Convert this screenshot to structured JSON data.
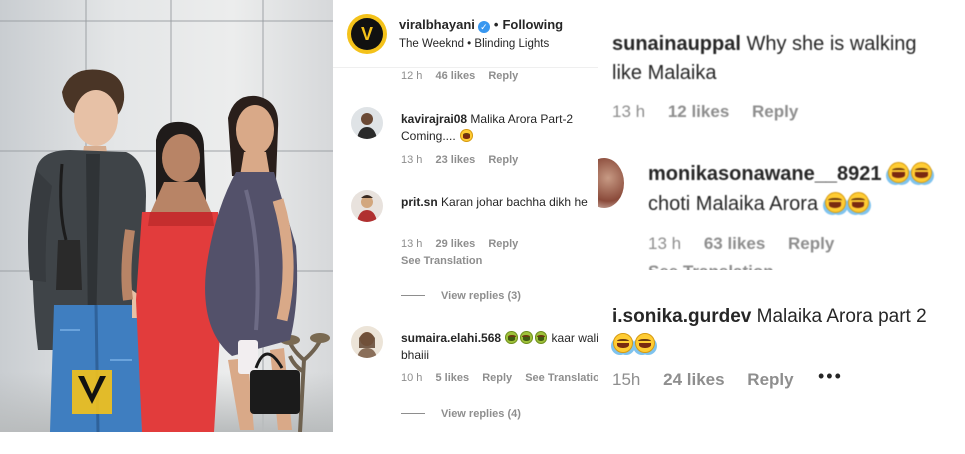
{
  "post": {
    "username": "viralbhayani",
    "follow_status": "Following",
    "song": "The Weeknd • Blinding Lights",
    "photo_watermark": "VIRAL BHAYANI"
  },
  "comments": {
    "top_meta": {
      "time": "12 h",
      "likes": "46 likes",
      "reply": "Reply"
    },
    "items": [
      {
        "username": "kavirajrai08",
        "text": "Malika Arora Part-2 Coming....",
        "emoji": "😆",
        "time": "13 h",
        "likes": "23 likes",
        "reply": "Reply"
      },
      {
        "username": "prit.sn",
        "text": "Karan johar bachha dikh he",
        "time": "13 h",
        "likes": "29 likes",
        "reply": "Reply",
        "see_translation": "See Translation",
        "view_replies": "View replies (3)"
      },
      {
        "username": "sumaira.elahi.568",
        "text": "kaar wali bhaiii",
        "emoji": "🤮🤮🤮",
        "time": "10 h",
        "likes": "5 likes",
        "reply": "Reply",
        "see_translation": "See Translatio",
        "view_replies": "View replies (4)"
      }
    ]
  },
  "zoomed_comments": [
    {
      "username": "sunainauppal",
      "text_line1": "Why she is walking",
      "text_line2": "like Malaika",
      "time": "13 h",
      "likes": "12 likes",
      "reply": "Reply"
    },
    {
      "username": "monikasonawane__8921",
      "text_line2": "choti Malaika Arora",
      "time": "13 h",
      "likes": "63 likes",
      "reply": "Reply",
      "cut_text": "See Translation"
    },
    {
      "username": "i.sonika.gurdev",
      "text": "Malaika Arora part 2",
      "emoji": "😂😂",
      "time": "15h",
      "likes": "24 likes",
      "reply": "Reply",
      "more": "•••"
    }
  ],
  "colors": {
    "meta_gray": "#8e8e8e",
    "text": "#262626",
    "verified_blue": "#3897f0",
    "brand_yellow": "#f4c21a"
  }
}
